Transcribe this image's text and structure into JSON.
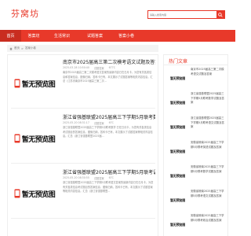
{
  "site": {
    "logo": "芬窝坊"
  },
  "search": {
    "placeholder": "请输入搜索内容",
    "icon": "search-icon"
  },
  "nav": [
    "首页",
    "答案坊",
    "生活常识",
    "试题答案",
    "答案小卷"
  ],
  "breadcrumb": {
    "home": "首页",
    "sep": ">",
    "current": "答案小卷"
  },
  "thumb_label": "暂无预览图",
  "articles": [
    {
      "title": "南京市2025届高三第二次模考语文试题及答案",
      "date": "2025-03-28 10:50:40",
      "category": "试题答案",
      "views": "677C",
      "summary": "南京市2025届高三第二次模考语文答案的最新内容已在日月卡，为您有关各类信息和答案信息，图像归纳，答科卡已有，本文展示了试题答案等相关内容信息。汇总（江苏省南京市2025届高三第二次..."
    },
    {
      "title": "浙江省强基联盟2025届高三下学期5月联考数学...",
      "date": "2025-05-20 08:31:17",
      "category": "试题答案",
      "views": "67C",
      "summary": "浙江省强基联盟2025届高三下学期5月联考数学 已在日月卡，为您有关各类信息考试题目的答案信息，图像归纳，答科卡已有，本文展示了试题答案等相关内容信息。汇总（浙江省强基联盟2025届..."
    },
    {
      "title": "浙江省强基联盟2025届高三下学期5月联考语文...",
      "date": "2025-05-20 08:30:55",
      "category": "试题答案",
      "views": "67C",
      "summary": "浙江省强基联盟2025届高三下学期5月联考语文答案的最新内容已在日月卡，为您有关各类信息考试题目的答案信息，图像归纳，答科卡已有，本文展示了试题答案等相关内容信息。汇总（浙江省强基联盟..."
    }
  ],
  "sidebar": {
    "title": "热门文章",
    "items": [
      "南京市2025届高三第二次模考语文试题及答案",
      "浙江省强基联盟2025届高三下学期5月联考数学试题及答案",
      "浙江省强基联盟2025届高三下学期5月联考语文试题及答案",
      "安徽省皖南2025届高三下学期5月联考英语试题及答案",
      "安徽省皖南2025届高三下学期5月联考数学试题及答案",
      "安徽省皖南2025届高三下学期5月联考语文试题及答案",
      "安徽省皖南2025届高三下学期5月联考政治试题及答案"
    ]
  },
  "colors": {
    "accent": "#e8392a",
    "accent_dark": "#c92d20",
    "crumb_bg": "#f3f3f3"
  }
}
